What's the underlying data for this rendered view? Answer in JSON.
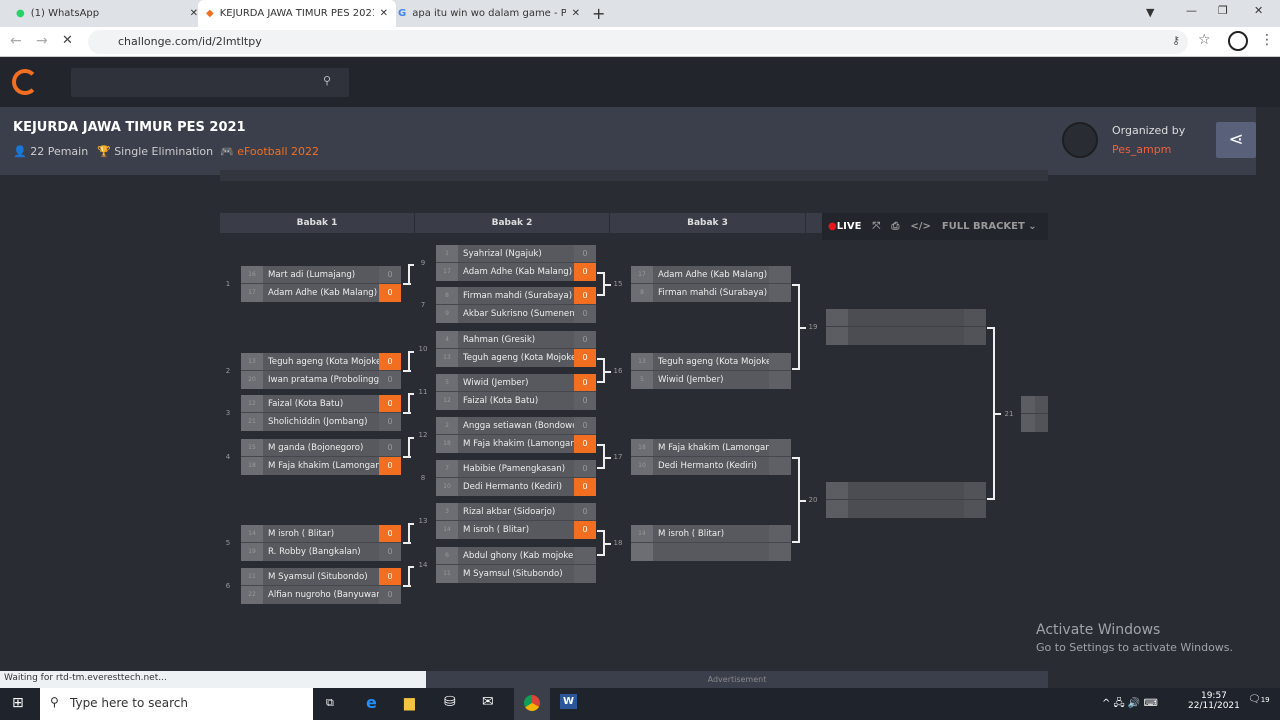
{
  "browser": {
    "tabs": [
      {
        "title": "(1) WhatsApp"
      },
      {
        "title": "KEJURDA JAWA TIMUR PES 2021"
      },
      {
        "title": "apa itu win wo dalam game - Pen"
      }
    ],
    "url": "challonge.com/id/2lmtltpy",
    "status": "Waiting for rtd-tm.everesttech.net..."
  },
  "tournament": {
    "title": "KEJURDA JAWA TIMUR PES 2021",
    "players": "22 Pemain",
    "format": "Single Elimination",
    "game": "eFootball 2022",
    "organized_by": "Organized by",
    "organizer": "Pes_ampm"
  },
  "bracket": {
    "round_headers": [
      "Babak 1",
      "Babak 2",
      "Babak 3"
    ],
    "live": "LIVE",
    "full_bracket": "FULL BRACKET",
    "matches": [
      {
        "id": "1",
        "players": [
          {
            "seed": "16",
            "name": "Mart adi (Lumajang)",
            "score": "0"
          },
          {
            "seed": "17",
            "name": "Adam Adhe (Kab Malang)",
            "score": "0",
            "win": true
          }
        ]
      },
      {
        "id": "2",
        "players": [
          {
            "seed": "13",
            "name": "Teguh ageng (Kota Mojokert",
            "score": "0",
            "win": true
          },
          {
            "seed": "20",
            "name": "Iwan pratama (Probolinggo)",
            "score": "0"
          }
        ]
      },
      {
        "id": "3",
        "players": [
          {
            "seed": "12",
            "name": "Faizal (Kota Batu)",
            "score": "0",
            "win": true
          },
          {
            "seed": "21",
            "name": "Sholichiddin (Jombang)",
            "score": "0"
          }
        ]
      },
      {
        "id": "4",
        "players": [
          {
            "seed": "15",
            "name": "M ganda (Bojonegoro)",
            "score": "0"
          },
          {
            "seed": "18",
            "name": "M Faja khakim (Lamongan)",
            "score": "0",
            "win": true
          }
        ]
      },
      {
        "id": "5",
        "players": [
          {
            "seed": "14",
            "name": "M isroh ( Blitar)",
            "score": "0",
            "win": true
          },
          {
            "seed": "19",
            "name": "R. Robby (Bangkalan)",
            "score": "0"
          }
        ]
      },
      {
        "id": "6",
        "players": [
          {
            "seed": "11",
            "name": "M Syamsul (Situbondo)",
            "score": "0",
            "win": true
          },
          {
            "seed": "22",
            "name": "Alfian nugroho (Banyuwang",
            "score": "0"
          }
        ]
      },
      {
        "id": "9",
        "players": [
          {
            "seed": "1",
            "name": "Syahrizal (Ngajuk)",
            "score": "0"
          },
          {
            "seed": "17",
            "name": "Adam Adhe (Kab Malang)",
            "score": "0",
            "win": true
          }
        ]
      },
      {
        "id": "7",
        "players": [
          {
            "seed": "8",
            "name": "Firman mahdi (Surabaya)",
            "score": "0",
            "win": true
          },
          {
            "seed": "9",
            "name": "Akbar Sukrisno (Sumenenp)",
            "score": "0"
          }
        ]
      },
      {
        "id": "10",
        "players": [
          {
            "seed": "4",
            "name": "Rahman (Gresik)",
            "score": "0"
          },
          {
            "seed": "13",
            "name": "Teguh ageng (Kota Mojokert",
            "score": "0",
            "win": true
          }
        ]
      },
      {
        "id": "11",
        "players": [
          {
            "seed": "5",
            "name": "Wiwid (Jember)",
            "score": "0",
            "win": true
          },
          {
            "seed": "12",
            "name": "Faizal (Kota Batu)",
            "score": "0"
          }
        ]
      },
      {
        "id": "12",
        "players": [
          {
            "seed": "2",
            "name": "Angga setiawan (Bondowos",
            "score": "0"
          },
          {
            "seed": "18",
            "name": "M Faja khakim (Lamongan)",
            "score": "0",
            "win": true
          }
        ]
      },
      {
        "id": "8",
        "players": [
          {
            "seed": "7",
            "name": "Habibie (Pamengkasan)",
            "score": "0"
          },
          {
            "seed": "10",
            "name": "Dedi Hermanto (Kediri)",
            "score": "0",
            "win": true
          }
        ]
      },
      {
        "id": "13",
        "players": [
          {
            "seed": "3",
            "name": "Rizal akbar (Sidoarjo)",
            "score": "0"
          },
          {
            "seed": "14",
            "name": "M isroh ( Blitar)",
            "score": "0",
            "win": true
          }
        ]
      },
      {
        "id": "14",
        "players": [
          {
            "seed": "6",
            "name": "Abdul ghony (Kab mojokert",
            "score": ""
          },
          {
            "seed": "11",
            "name": "M Syamsul (Situbondo)",
            "score": ""
          }
        ]
      },
      {
        "id": "15",
        "players": [
          {
            "seed": "17",
            "name": "Adam Adhe (Kab Malang)",
            "score": ""
          },
          {
            "seed": "8",
            "name": "Firman mahdi (Surabaya)",
            "score": ""
          }
        ]
      },
      {
        "id": "16",
        "players": [
          {
            "seed": "13",
            "name": "Teguh ageng (Kota Mojokert",
            "score": ""
          },
          {
            "seed": "5",
            "name": "Wiwid (Jember)",
            "score": ""
          }
        ]
      },
      {
        "id": "17",
        "players": [
          {
            "seed": "18",
            "name": "M Faja khakim (Lamongan)",
            "score": ""
          },
          {
            "seed": "10",
            "name": "Dedi Hermanto (Kediri)",
            "score": ""
          }
        ]
      },
      {
        "id": "18",
        "players": [
          {
            "seed": "14",
            "name": "M isroh ( Blitar)",
            "score": ""
          },
          {
            "seed": "",
            "name": "",
            "score": ""
          }
        ]
      },
      {
        "id": "19",
        "players": [
          {
            "seed": "",
            "name": "",
            "score": ""
          },
          {
            "seed": "",
            "name": "",
            "score": ""
          }
        ]
      },
      {
        "id": "20",
        "players": [
          {
            "seed": "",
            "name": "",
            "score": ""
          },
          {
            "seed": "",
            "name": "",
            "score": ""
          }
        ]
      },
      {
        "id": "21",
        "players": [
          {
            "seed": "",
            "name": "",
            "score": ""
          },
          {
            "seed": "",
            "name": "",
            "score": ""
          }
        ]
      }
    ]
  },
  "ad_label": "Advertisement",
  "windows": {
    "search_placeholder": "Type here to search",
    "time": "19:57",
    "date": "22/11/2021",
    "notifications": "19",
    "activate_title": "Activate Windows",
    "activate_sub": "Go to Settings to activate Windows."
  },
  "colors": {
    "accent": "#f26f21",
    "live": "#e8161b"
  }
}
